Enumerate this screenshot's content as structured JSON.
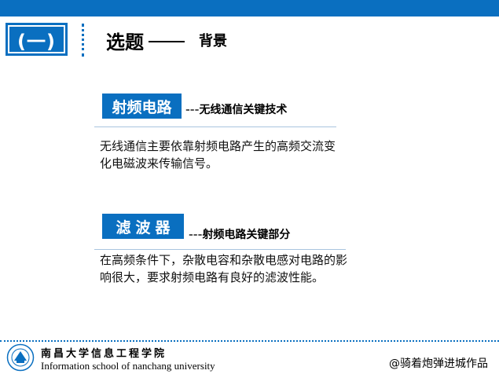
{
  "header": {
    "section_number": "(一)",
    "title": "选题",
    "subtitle": "背景"
  },
  "sections": [
    {
      "tag": "射频电路",
      "lead": "---",
      "caption": "无线通信关键技术",
      "body": "无线通信主要依靠射频电路产生的高频交流变化电磁波来传输信号。"
    },
    {
      "tag": "滤波器",
      "lead": "---",
      "caption": "射频电路关键部分",
      "body": "在高频条件下，杂散电容和杂散电感对电路的影响很大，要求射频电路有良好的滤波性能。"
    }
  ],
  "footer": {
    "school_cn": "南昌大学信息工程学院",
    "school_en": "Information school of nanchang university",
    "credit": "@骑着炮弹进城作品"
  },
  "colors": {
    "accent": "#0a6fc0",
    "rule": "#a9c5df"
  }
}
